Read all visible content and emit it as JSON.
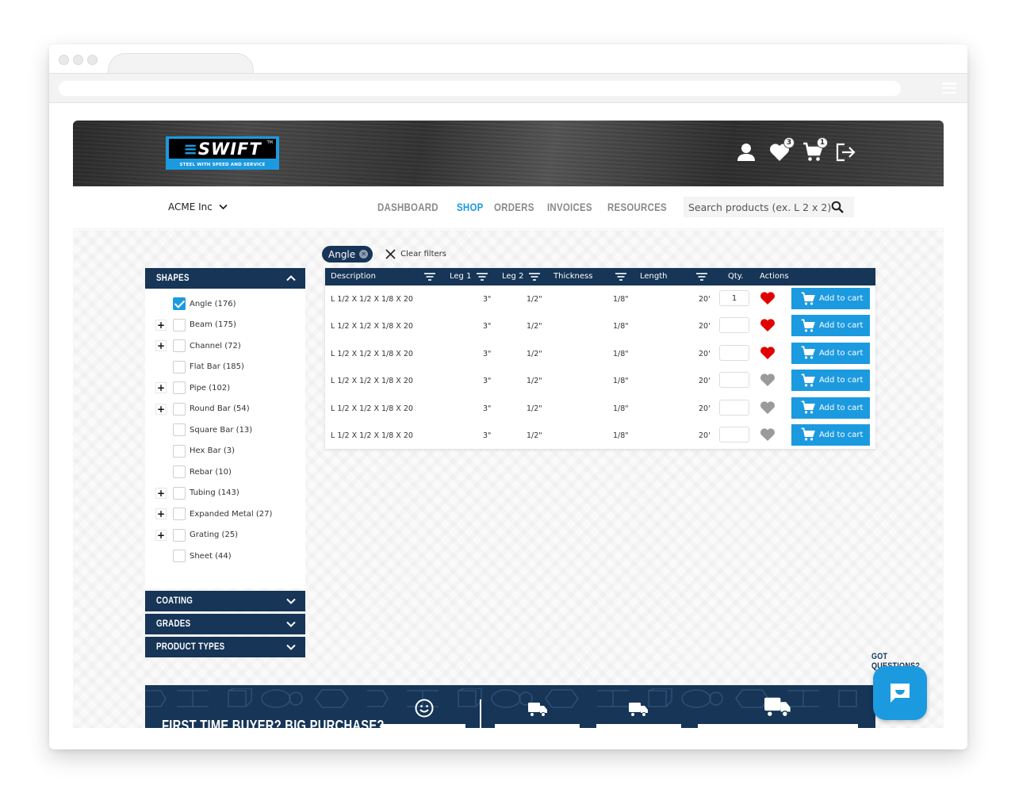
{
  "brand": {
    "name": "SWIFT",
    "trademark": "TM",
    "tagline": "STEEL WITH SPEED AND SERVICE",
    "primary_color": "#163557",
    "accent_color": "#1c9ae0",
    "favorite_color": "#e00000"
  },
  "header": {
    "icons": [
      {
        "name": "user-icon"
      },
      {
        "name": "wishlist-icon",
        "badge": "3"
      },
      {
        "name": "cart-icon",
        "badge": "1"
      },
      {
        "name": "logout-icon"
      }
    ]
  },
  "nav": {
    "company": "ACME Inc",
    "links": [
      {
        "label": "DASHBOARD",
        "active": false
      },
      {
        "label": "SHOP",
        "active": true
      },
      {
        "label": "ORDERS",
        "active": false
      },
      {
        "label": "INVOICES",
        "active": false
      },
      {
        "label": "RESOURCES",
        "active": false
      }
    ],
    "search_placeholder": "Search products (ex. L 2 x 2)"
  },
  "filters": {
    "active_chip": "Angle",
    "clear_label": "Clear filters"
  },
  "sidebar": {
    "shapes_title": "SHAPES",
    "shapes": [
      {
        "label": "Angle (176)",
        "checked": true,
        "expandable": false
      },
      {
        "label": "Beam (175)",
        "checked": false,
        "expandable": true
      },
      {
        "label": "Channel (72)",
        "checked": false,
        "expandable": true
      },
      {
        "label": "Flat Bar (185)",
        "checked": false,
        "expandable": false
      },
      {
        "label": "Pipe (102)",
        "checked": false,
        "expandable": true
      },
      {
        "label": "Round Bar (54)",
        "checked": false,
        "expandable": true
      },
      {
        "label": "Square Bar (13)",
        "checked": false,
        "expandable": false
      },
      {
        "label": "Hex Bar (3)",
        "checked": false,
        "expandable": false
      },
      {
        "label": "Rebar (10)",
        "checked": false,
        "expandable": false
      },
      {
        "label": "Tubing (143)",
        "checked": false,
        "expandable": true
      },
      {
        "label": "Expanded Metal (27)",
        "checked": false,
        "expandable": true
      },
      {
        "label": "Grating (25)",
        "checked": false,
        "expandable": true
      },
      {
        "label": "Sheet (44)",
        "checked": false,
        "expandable": false
      }
    ],
    "collapsed_panels": [
      "COATING",
      "GRADES",
      "PRODUCT TYPES"
    ]
  },
  "table": {
    "columns": [
      "Description",
      "Leg 1",
      "Leg 2",
      "Thickness",
      "Length",
      "Qty.",
      "Actions"
    ],
    "add_to_cart_label": "Add to cart",
    "rows": [
      {
        "description": "L 1/2 X 1/2 X 1/8 X 20",
        "leg1": "3\"",
        "leg2": "1/2\"",
        "thickness": "1/8\"",
        "length": "20'",
        "qty": "1",
        "favorite": true
      },
      {
        "description": "L 1/2 X 1/2 X 1/8 X 20",
        "leg1": "3\"",
        "leg2": "1/2\"",
        "thickness": "1/8\"",
        "length": "20'",
        "qty": "",
        "favorite": true
      },
      {
        "description": "L 1/2 X 1/2 X 1/8 X 20",
        "leg1": "3\"",
        "leg2": "1/2\"",
        "thickness": "1/8\"",
        "length": "20'",
        "qty": "",
        "favorite": true
      },
      {
        "description": "L 1/2 X 1/2 X 1/8 X 20",
        "leg1": "3\"",
        "leg2": "1/2\"",
        "thickness": "1/8\"",
        "length": "20'",
        "qty": "",
        "favorite": false
      },
      {
        "description": "L 1/2 X 1/2 X 1/8 X 20",
        "leg1": "3\"",
        "leg2": "1/2\"",
        "thickness": "1/8\"",
        "length": "20'",
        "qty": "",
        "favorite": false
      },
      {
        "description": "L 1/2 X 1/2 X 1/8 X 20",
        "leg1": "3\"",
        "leg2": "1/2\"",
        "thickness": "1/8\"",
        "length": "20'",
        "qty": "",
        "favorite": false
      }
    ]
  },
  "banner": {
    "title": "FIRST TIME BUYER? BIG PURCHASE?",
    "icons": [
      "smiley-icon",
      "truck-icon",
      "truck-icon",
      "truck-icon"
    ]
  },
  "chat": {
    "label": "GOT QUESTIONS?"
  }
}
